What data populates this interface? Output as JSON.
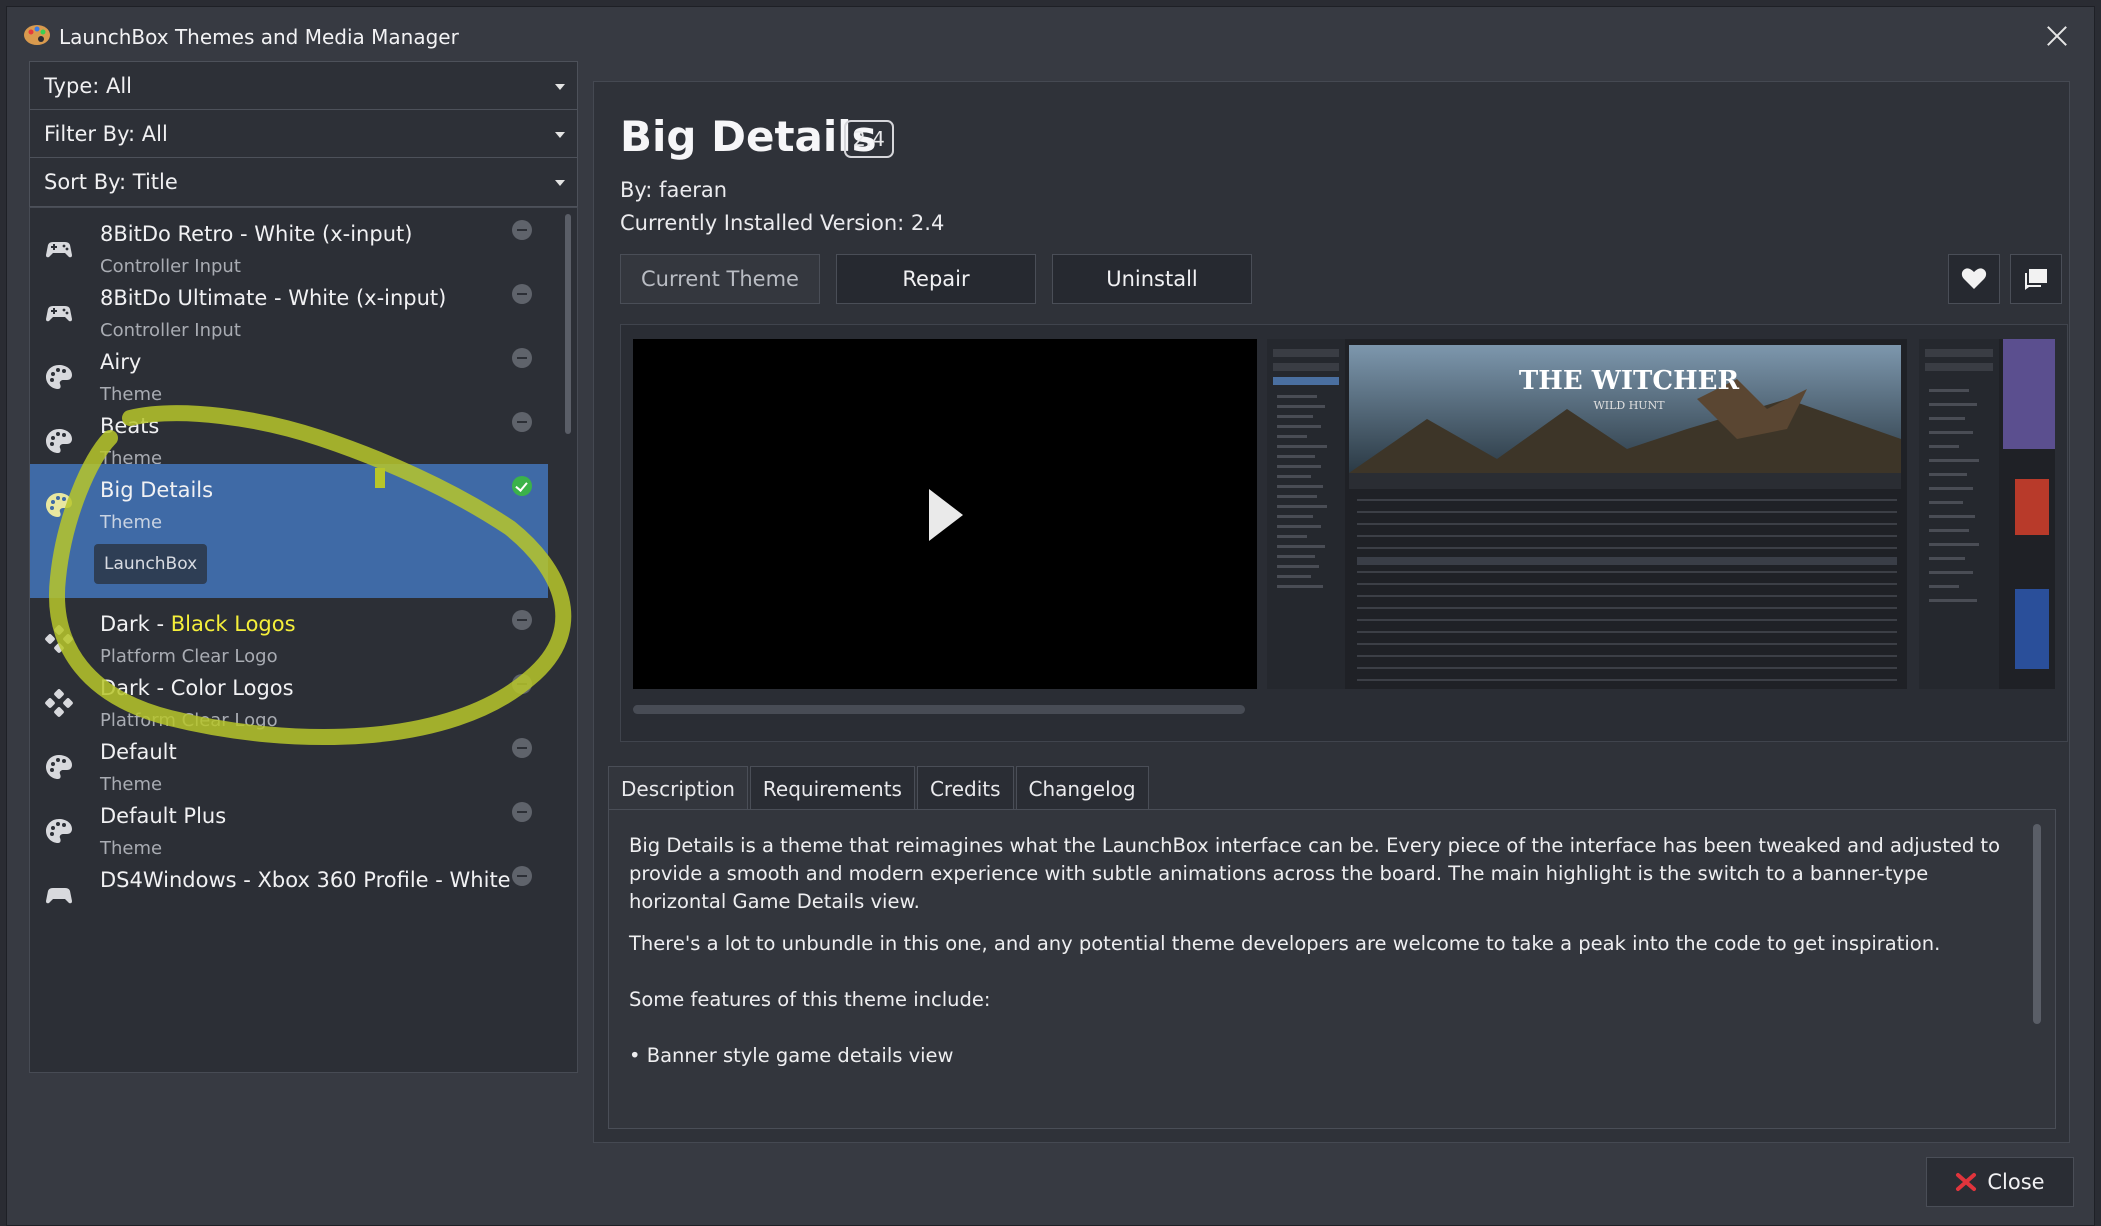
{
  "window": {
    "title": "LaunchBox Themes and Media Manager"
  },
  "filters": {
    "type": "Type: All",
    "filter_by": "Filter By: All",
    "sort_by": "Sort By: Title"
  },
  "list": {
    "items": [
      {
        "name": "8BitDo Retro - White (x-input)",
        "sub": "Controller Input",
        "icon": "gamepad-icon"
      },
      {
        "name": "8BitDo Ultimate - White (x-input)",
        "sub": "Controller Input",
        "icon": "gamepad-icon"
      },
      {
        "name": "Airy",
        "sub": "Theme",
        "icon": "palette-icon"
      },
      {
        "name": "Beats",
        "sub": "Theme",
        "icon": "palette-icon"
      },
      {
        "name": "Big Details",
        "sub": "Theme",
        "icon": "palette-icon",
        "tag": "LaunchBox",
        "installed": true
      },
      {
        "name_prefix": "Dark - ",
        "name_hl": "Black Logos",
        "sub": "Platform Clear Logo",
        "icon": "dpad-icon"
      },
      {
        "name": "Dark - Color Logos",
        "sub": "Platform Clear Logo",
        "icon": "dpad-icon"
      },
      {
        "name": "Default",
        "sub": "Theme",
        "icon": "palette-icon"
      },
      {
        "name": "Default Plus",
        "sub": "Theme",
        "icon": "palette-icon"
      },
      {
        "name": "DS4Windows - Xbox 360 Profile - White",
        "sub": "",
        "icon": "gamepad-icon"
      }
    ]
  },
  "detail": {
    "title": "Big Details",
    "version_badge": "2.4",
    "author": "By: faeran",
    "installed": "Currently Installed Version: 2.4",
    "buttons": {
      "current": "Current Theme",
      "repair": "Repair",
      "uninstall": "Uninstall"
    },
    "tabs": [
      "Description",
      "Requirements",
      "Credits",
      "Changelog"
    ],
    "description": [
      "Big Details is a theme that reimagines what the LaunchBox interface can be. Every piece of the interface has been tweaked and adjusted to provide a smooth and modern experience with subtle animations across the board. The main highlight is the switch to a banner-type horizontal Game Details view.",
      "There's a lot to unbundle in this one, and any potential theme developers are welcome to take a peak into the code to get inspiration.",
      "Some features of this theme include:",
      "• Banner style game details view"
    ],
    "screenshot_text": {
      "witcher": "THE WITCHER",
      "wild_hunt": "WILD HUNT"
    }
  },
  "footer": {
    "close": "Close"
  },
  "colors": {
    "selected_row": "#3f6aa6",
    "highlight": "#f5ef3a",
    "installed_check": "#3bb24a",
    "close_icon": "#e0343c"
  }
}
